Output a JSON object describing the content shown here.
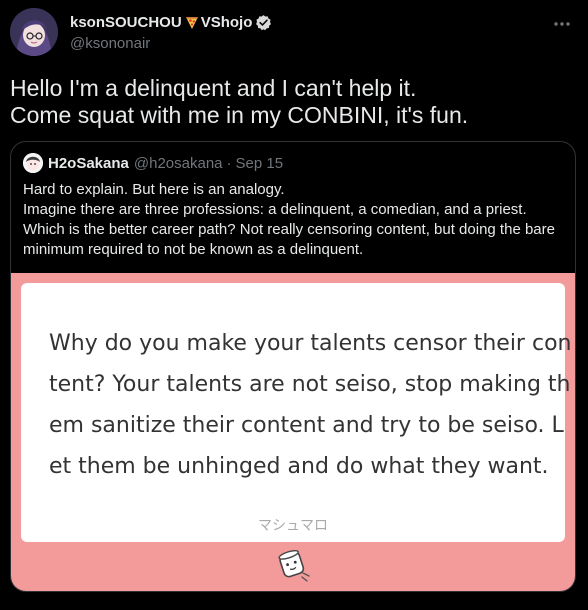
{
  "author": {
    "display_name": "ksonSOUCHOU",
    "affiliation": "VShojo",
    "handle": "@ksononair",
    "avatar_icon": "avatar-image",
    "emoji_icon": "pizza-icon",
    "verified_icon": "verified-badge-icon",
    "more_icon": "more-options-icon"
  },
  "tweet": {
    "lines": [
      "Hello I'm a delinquent and I can't help it.",
      "Come squat with me in my CONBINI, it's fun."
    ]
  },
  "quote": {
    "name": "H2oSakana",
    "handle": "@h2osakana",
    "separator": "·",
    "date": "Sep 15",
    "lines": [
      "Hard to explain. But here is an analogy.",
      "Imagine there are three professions: a delinquent, a comedian, and a priest.",
      "Which is the better career path? Not really censoring content, but doing the bare",
      "minimum required to not be known as a delinquent."
    ]
  },
  "marshmallow": {
    "lines": [
      "Why do you make your talents censor their con",
      "tent? Your talents are not seiso, stop making th",
      "em sanitize their content and try to be seiso. L",
      "et them be unhinged and do what they want."
    ],
    "brand": "マシュマロ",
    "background_color": "#f39a9a",
    "mascot_icon": "marshmallow-mascot-icon"
  },
  "colors": {
    "background": "#000000",
    "text": "#e7e9ea",
    "muted": "#71767b",
    "border": "#2f3336",
    "verified": "#1d9bf0"
  }
}
